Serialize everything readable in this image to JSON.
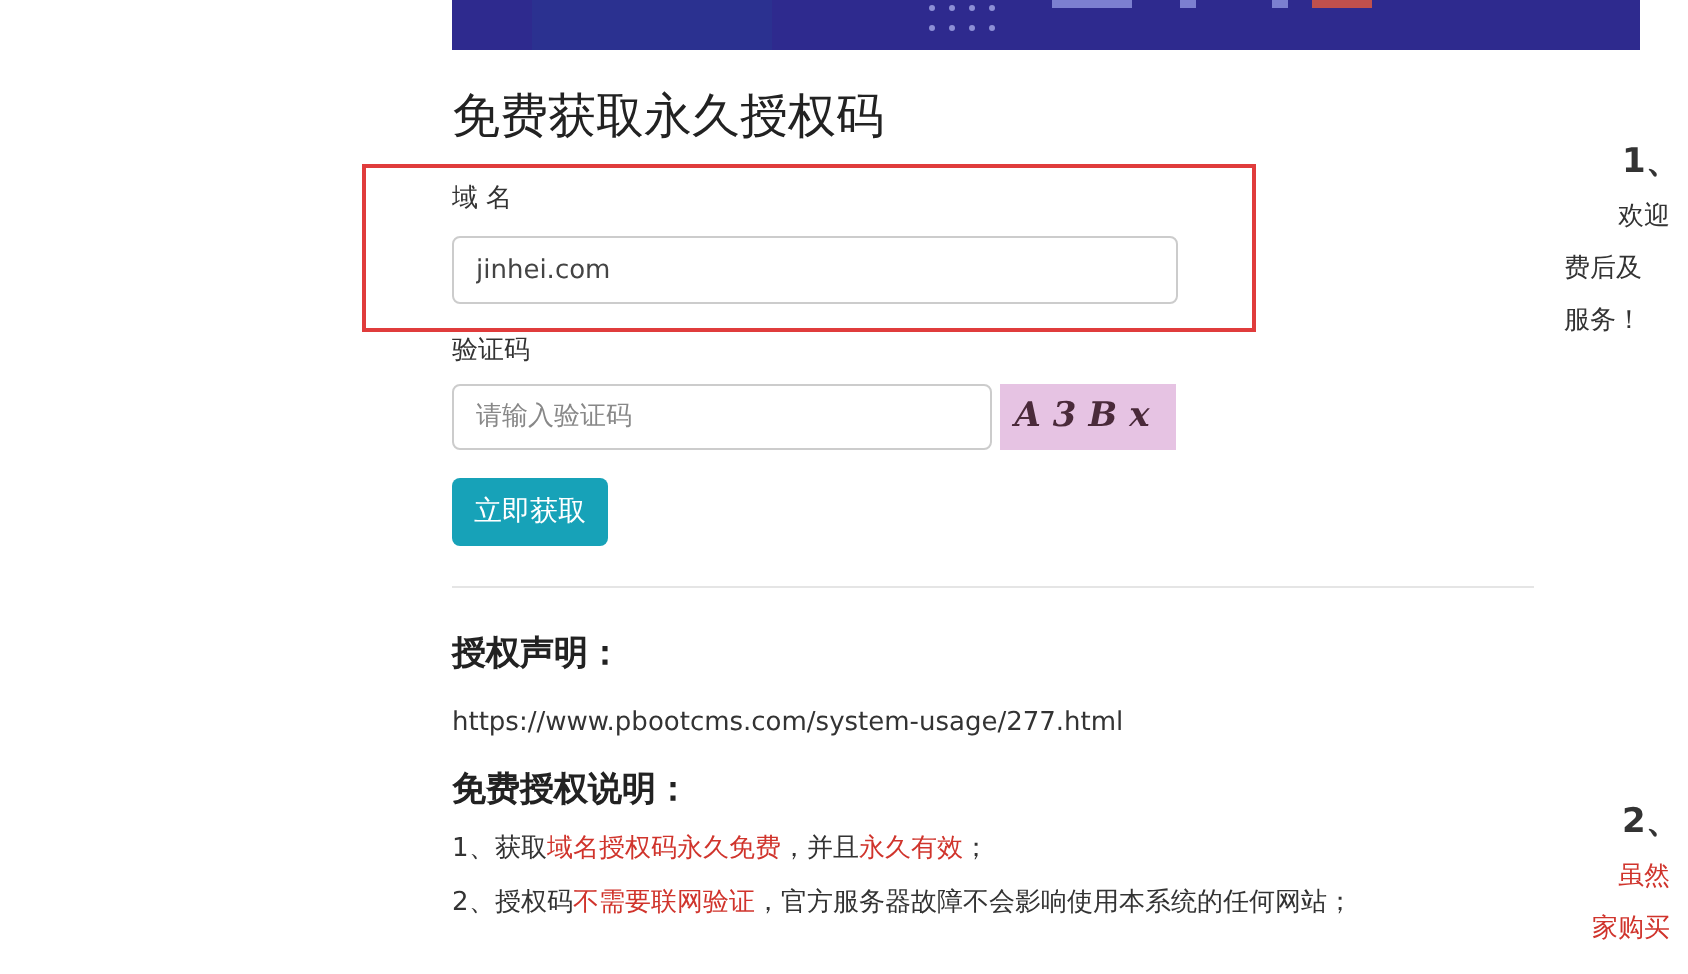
{
  "title": "免费获取永久授权码",
  "form": {
    "domain": {
      "label": "域 名",
      "value": "jinhei.com",
      "highlighted": true
    },
    "captcha": {
      "label": "验证码",
      "placeholder": "请输入验证码",
      "code": "A3Bx"
    },
    "submit": "立即获取"
  },
  "notice": {
    "heading": "授权声明：",
    "url": "https://www.pbootcms.com/system-usage/277.html"
  },
  "free": {
    "heading": "免费授权说明：",
    "items": [
      "1、获取**域名授权码永久免费**，并且**永久有效**；",
      "2、授权码**不需要联网验证**，官方服务器故障不会影响使用本系统的任何网站；"
    ]
  },
  "sidebar": {
    "sections": [
      {
        "heading": "1、",
        "lines": [
          {
            "text": "欢迎",
            "red": false
          },
          {
            "text": "费后及",
            "red": false
          },
          {
            "text": "服务！",
            "red": false
          }
        ]
      },
      {
        "heading": "2、",
        "lines": [
          {
            "text": "虽然",
            "red": true
          },
          {
            "text": "家购买",
            "red": true
          }
        ]
      }
    ]
  }
}
